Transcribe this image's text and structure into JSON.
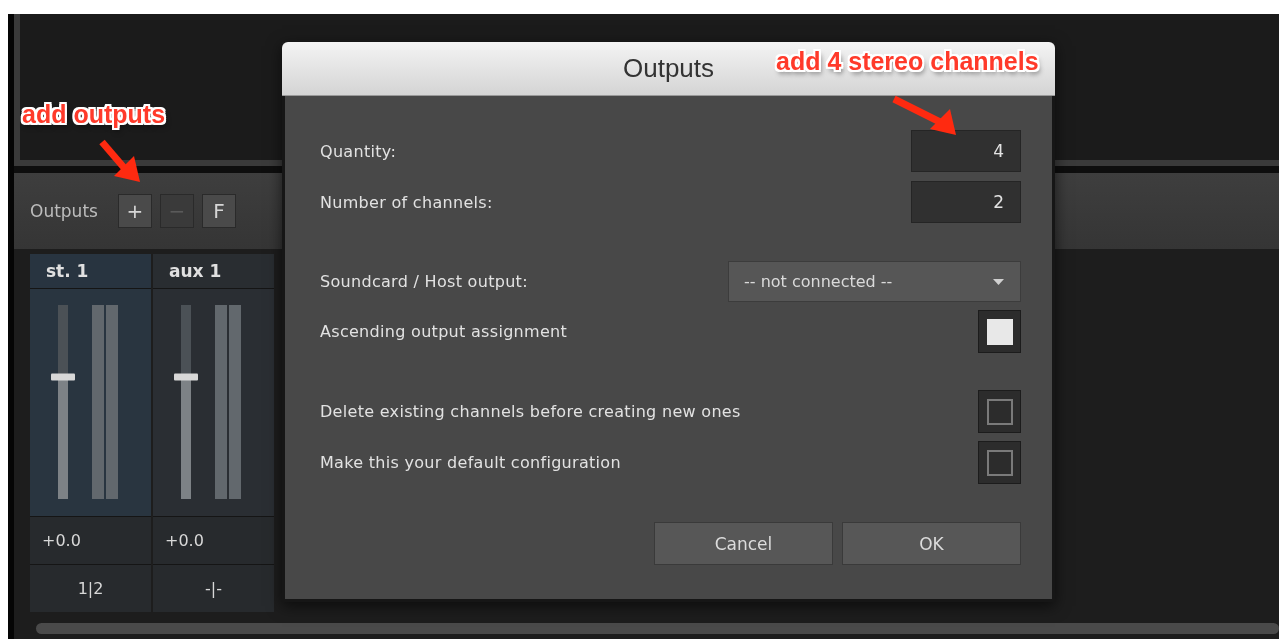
{
  "mixer": {
    "label": "Outputs",
    "buttons": [
      {
        "label": "+",
        "disabled": false
      },
      {
        "label": "−",
        "disabled": true
      },
      {
        "label": "F",
        "disabled": false
      }
    ]
  },
  "channels": [
    {
      "name": "st. 1",
      "selected": true,
      "level": 0.63,
      "gain": "+0.0",
      "routing": "1|2"
    },
    {
      "name": "aux 1",
      "selected": false,
      "level": 0.63,
      "gain": "+0.0",
      "routing": "-|-"
    }
  ],
  "dialog": {
    "title": "Outputs",
    "fields": [
      {
        "label": "Quantity:",
        "value": "4"
      },
      {
        "label": "Number of channels:",
        "value": "2"
      }
    ],
    "output_select": {
      "label": "Soundcard / Host output:",
      "value": "-- not connected --"
    },
    "assignment_option": {
      "label": "Ascending output assignment",
      "checked": true
    },
    "options": [
      {
        "label": "Delete existing channels before creating new ones",
        "checked": false
      },
      {
        "label": "Make this your default configuration",
        "checked": false
      }
    ],
    "buttons": [
      "Cancel",
      "OK"
    ]
  },
  "annotations": [
    {
      "text": "add outputs"
    },
    {
      "text": "add 4 stereo channels"
    }
  ]
}
